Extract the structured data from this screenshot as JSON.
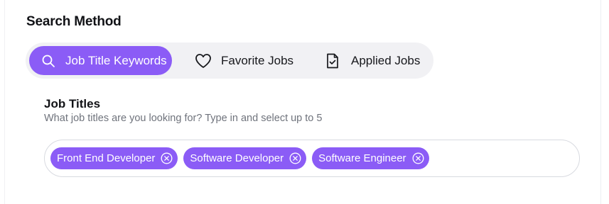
{
  "section": {
    "title": "Search Method"
  },
  "search_methods": [
    {
      "label": "Job Title Keywords",
      "icon": "search-icon",
      "active": true
    },
    {
      "label": "Favorite Jobs",
      "icon": "heart-icon",
      "active": false
    },
    {
      "label": "Applied Jobs",
      "icon": "document-check-icon",
      "active": false
    }
  ],
  "job_titles": {
    "label": "Job Titles",
    "help_text": "What job titles are you looking for? Type in and select up to 5",
    "selected": [
      "Front End Developer",
      "Software Developer",
      "Software Engineer"
    ]
  },
  "colors": {
    "accent": "#8b5cf6",
    "segment_bg": "#f1f1f4",
    "text": "#111216",
    "muted": "#6f737c",
    "border": "#d8dae0"
  }
}
